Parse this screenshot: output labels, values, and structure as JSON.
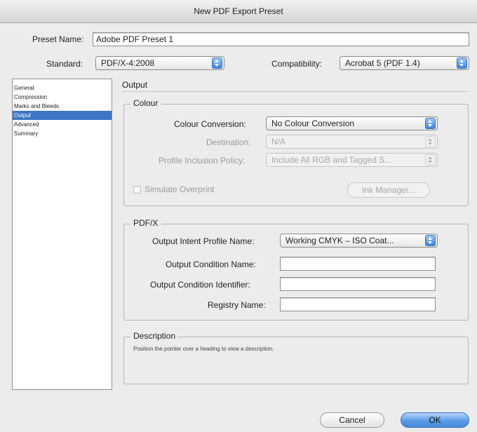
{
  "window": {
    "title": "New PDF Export Preset"
  },
  "preset": {
    "label": "Preset Name:",
    "value": "Adobe PDF Preset 1"
  },
  "standard": {
    "label": "Standard:",
    "value": "PDF/X-4:2008"
  },
  "compatibility": {
    "label": "Compatibility:",
    "value": "Acrobat 5 (PDF 1.4)"
  },
  "sidebar": {
    "items": [
      {
        "label": "General"
      },
      {
        "label": "Compression"
      },
      {
        "label": "Marks and Bleeds"
      },
      {
        "label": "Output",
        "selected": true
      },
      {
        "label": "Advanced"
      },
      {
        "label": "Summary"
      }
    ]
  },
  "output": {
    "heading": "Output",
    "colour": {
      "title": "Colour",
      "conversion_label": "Colour Conversion:",
      "conversion_value": "No Colour Conversion",
      "destination_label": "Destination:",
      "destination_value": "N/A",
      "profile_label": "Profile Inclusion Policy:",
      "profile_value": "Include All RGB and Tagged S...",
      "simulate_label": "Simulate Overprint",
      "ink_manager_label": "Ink Manager..."
    },
    "pdfx": {
      "title": "PDF/X",
      "intent_label": "Output Intent Profile Name:",
      "intent_value": "Working CMYK – ISO Coat...",
      "condition_name_label": "Output Condition Name:",
      "condition_name_value": "",
      "condition_id_label": "Output Condition Identifier:",
      "condition_id_value": "",
      "registry_label": "Registry Name:",
      "registry_value": ""
    },
    "description": {
      "title": "Description",
      "text": "Position the pointer over a heading to view a description."
    }
  },
  "buttons": {
    "cancel": "Cancel",
    "ok": "OK"
  },
  "colors": {
    "accent": "#3c76c4",
    "default_button": "#5b9be6"
  }
}
